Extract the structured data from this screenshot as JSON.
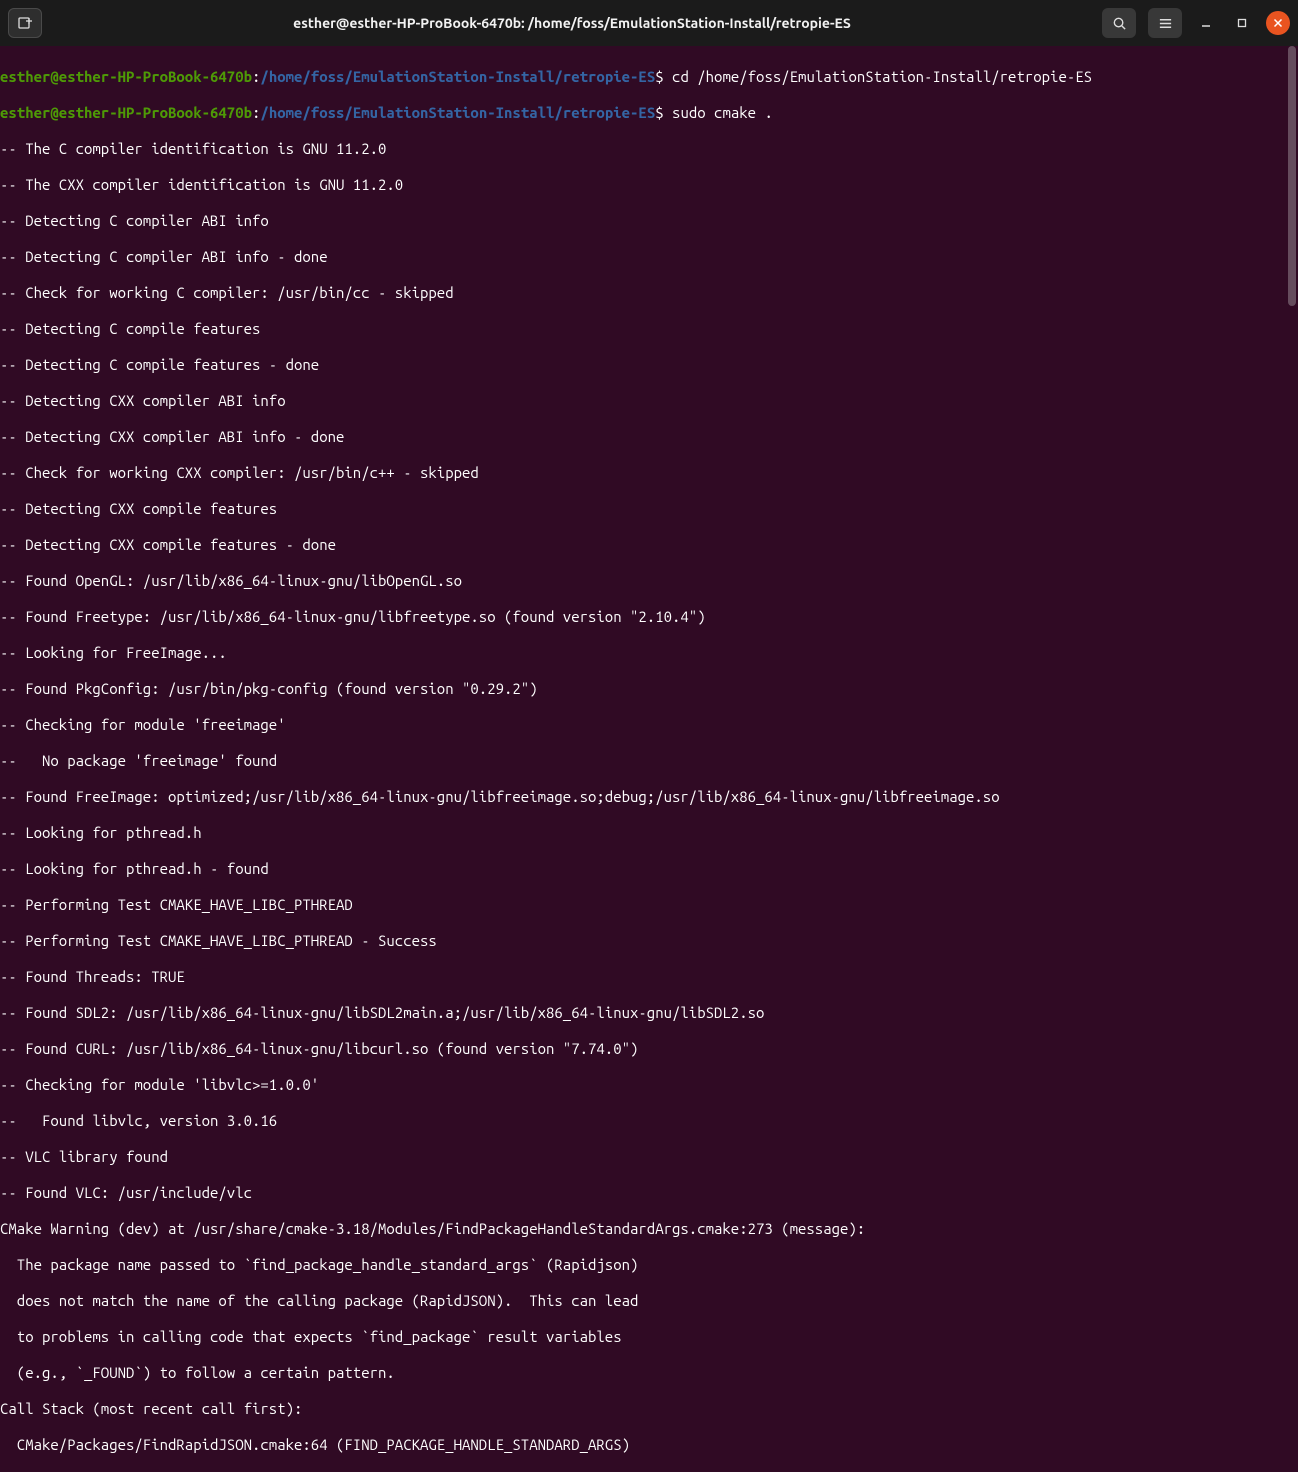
{
  "titlebar": {
    "title": "esther@esther-HP-ProBook-6470b: /home/foss/EmulationStation-Install/retropie-ES"
  },
  "prompt": {
    "user": "esther@esther-HP-ProBook-6470b",
    "colon": ":",
    "path": "/home/foss/EmulationStation-Install/retropie-ES",
    "dollar": "$ "
  },
  "commands": {
    "cd": "cd /home/foss/EmulationStation-Install/retropie-ES",
    "sudo": "sudo cmake ."
  },
  "out": {
    "l1": "-- The C compiler identification is GNU 11.2.0",
    "l2": "-- The CXX compiler identification is GNU 11.2.0",
    "l3": "-- Detecting C compiler ABI info",
    "l4": "-- Detecting C compiler ABI info - done",
    "l5": "-- Check for working C compiler: /usr/bin/cc - skipped",
    "l6": "-- Detecting C compile features",
    "l7": "-- Detecting C compile features - done",
    "l8": "-- Detecting CXX compiler ABI info",
    "l9": "-- Detecting CXX compiler ABI info - done",
    "l10": "-- Check for working CXX compiler: /usr/bin/c++ - skipped",
    "l11": "-- Detecting CXX compile features",
    "l12": "-- Detecting CXX compile features - done",
    "l13": "-- Found OpenGL: /usr/lib/x86_64-linux-gnu/libOpenGL.so",
    "l14": "-- Found Freetype: /usr/lib/x86_64-linux-gnu/libfreetype.so (found version \"2.10.4\")",
    "l15": "-- Looking for FreeImage...",
    "l16": "-- Found PkgConfig: /usr/bin/pkg-config (found version \"0.29.2\")",
    "l17": "-- Checking for module 'freeimage'",
    "l18": "--   No package 'freeimage' found",
    "l19": "-- Found FreeImage: optimized;/usr/lib/x86_64-linux-gnu/libfreeimage.so;debug;/usr/lib/x86_64-linux-gnu/libfreeimage.so",
    "l20": "-- Looking for pthread.h",
    "l21": "-- Looking for pthread.h - found",
    "l22": "-- Performing Test CMAKE_HAVE_LIBC_PTHREAD",
    "l23": "-- Performing Test CMAKE_HAVE_LIBC_PTHREAD - Success",
    "l24": "-- Found Threads: TRUE",
    "l25": "-- Found SDL2: /usr/lib/x86_64-linux-gnu/libSDL2main.a;/usr/lib/x86_64-linux-gnu/libSDL2.so",
    "l26": "-- Found CURL: /usr/lib/x86_64-linux-gnu/libcurl.so (found version \"7.74.0\")",
    "l27": "-- Checking for module 'libvlc>=1.0.0'",
    "l28": "--   Found libvlc, version 3.0.16",
    "l29": "-- VLC library found",
    "l30": "-- Found VLC: /usr/include/vlc",
    "l31": "CMake Warning (dev) at /usr/share/cmake-3.18/Modules/FindPackageHandleStandardArgs.cmake:273 (message):",
    "l32": "  The package name passed to `find_package_handle_standard_args` (Rapidjson)",
    "l33": "  does not match the name of the calling package (RapidJSON).  This can lead",
    "l34": "  to problems in calling code that expects `find_package` result variables",
    "l35": "  (e.g., `_FOUND`) to follow a certain pattern.",
    "l36": "Call Stack (most recent call first):",
    "l37": "  CMake/Packages/FindRapidJSON.cmake:64 (FIND_PACKAGE_HANDLE_STANDARD_ARGS)"
  }
}
